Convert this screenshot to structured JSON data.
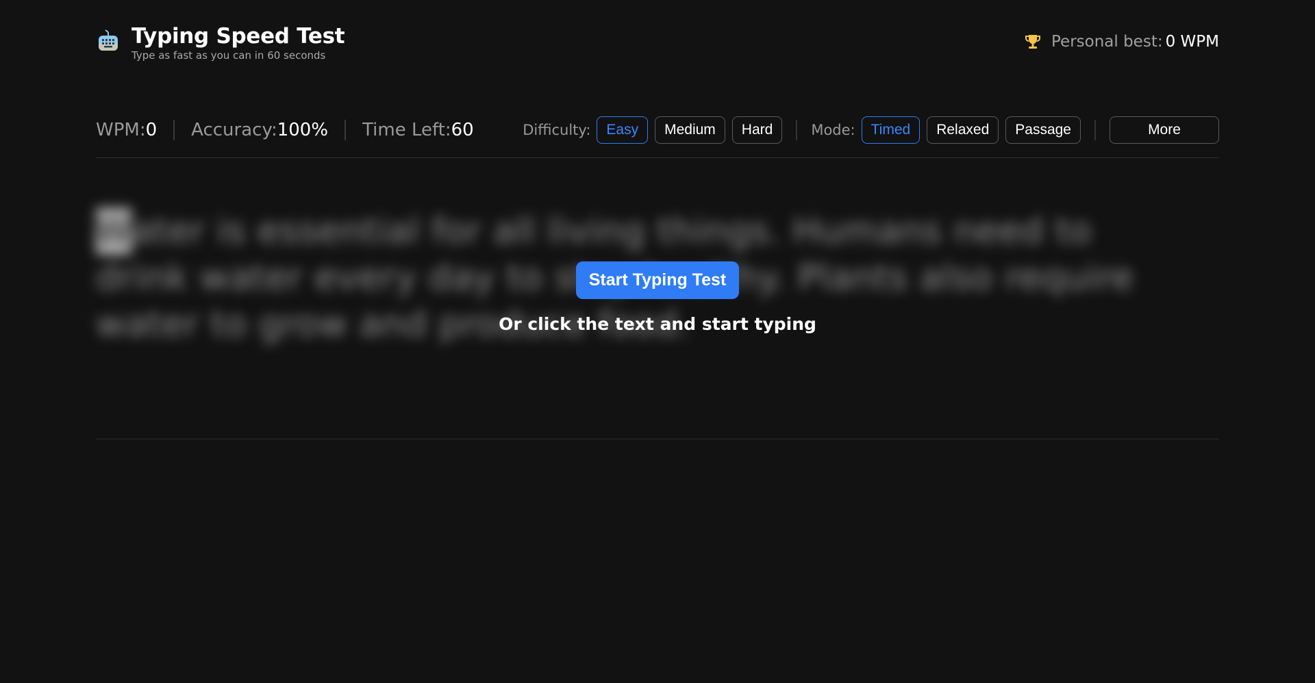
{
  "header": {
    "title": "Typing Speed Test",
    "subtitle": "Type as fast as you can in 60 seconds",
    "icon": "keyboard-robot-icon",
    "personal_best_label": "Personal best:",
    "personal_best_value": "0 WPM",
    "trophy_icon": "trophy-icon"
  },
  "stats": {
    "wpm_label": "WPM:",
    "wpm_value": "0",
    "accuracy_label": "Accuracy:",
    "accuracy_value": "100%",
    "time_label": "Time Left:",
    "time_value": "60"
  },
  "difficulty": {
    "label": "Difficulty:",
    "options": [
      "Easy",
      "Medium",
      "Hard"
    ],
    "selected": "Easy"
  },
  "mode": {
    "label": "Mode:",
    "options": [
      "Timed",
      "Relaxed",
      "Passage"
    ],
    "selected": "Timed"
  },
  "more_label": "More",
  "passage": {
    "first_char": "W",
    "rest": "ater is essential for all living things. Humans need to drink water every day to stay healthy. Plants also require water to grow and produce food."
  },
  "overlay": {
    "start_label": "Start Typing Test",
    "hint": "Or click the text and start typing"
  },
  "colors": {
    "background": "#121212",
    "accent": "#2f7cf6",
    "trophy": "#f5c542"
  }
}
